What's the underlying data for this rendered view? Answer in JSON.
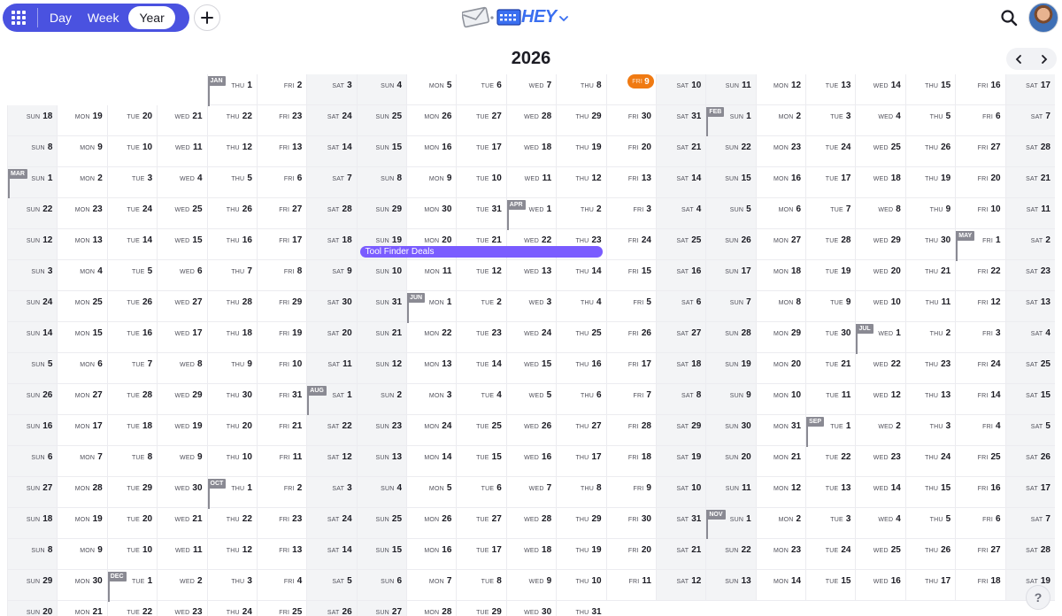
{
  "header": {
    "views": [
      "Day",
      "Week",
      "Year"
    ],
    "active_view": "Year",
    "apps_icon": "grid-icon",
    "add_icon": "plus-icon",
    "logo_text": "HEY",
    "search_icon": "search-icon",
    "avatar_icon": "user-avatar"
  },
  "calendar": {
    "year": "2026",
    "prev_icon": "chevron-left-icon",
    "next_icon": "chevron-right-icon",
    "today": "2026-01-09",
    "months": [
      "JAN",
      "FEB",
      "MAR",
      "APR",
      "MAY",
      "JUN",
      "JUL",
      "AUG",
      "SEP",
      "OCT",
      "NOV",
      "DEC"
    ],
    "weekdays": [
      "SUN",
      "MON",
      "TUE",
      "WED",
      "THU",
      "FRI",
      "SAT"
    ],
    "days_in_month": [
      31,
      28,
      31,
      30,
      31,
      30,
      31,
      31,
      30,
      31,
      30,
      31
    ]
  },
  "events": [
    {
      "title": "Tool Finder Deals",
      "start": "2026-04-19",
      "end": "2026-04-23",
      "color": "#7a5cff"
    }
  ],
  "colors": {
    "accent": "#4a52e0",
    "today": "#f07a12",
    "event": "#7a5cff",
    "weekend": "#f3f4f6"
  },
  "help": {
    "label": "?"
  }
}
